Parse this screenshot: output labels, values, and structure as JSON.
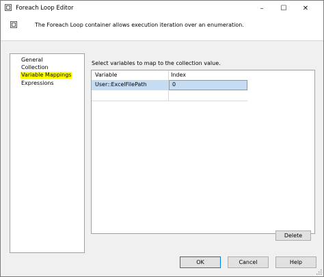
{
  "window": {
    "title": "Foreach Loop Editor",
    "controls": {
      "minimize": "–",
      "maximize": "☐",
      "close": "✕"
    }
  },
  "header": {
    "description": "The Foreach Loop container allows execution iteration over an enumeration."
  },
  "nav": {
    "items": [
      {
        "label": "General"
      },
      {
        "label": "Collection"
      },
      {
        "label": "Variable Mappings",
        "selected": true
      },
      {
        "label": "Expressions"
      }
    ],
    "highlight_color": "#ffff00"
  },
  "main": {
    "instruction": "Select variables to map to the collection value.",
    "grid": {
      "columns": [
        "Variable",
        "Index"
      ],
      "rows": [
        {
          "variable": "User::ExcelFilePath",
          "index": "0"
        }
      ]
    },
    "delete_label": "Delete"
  },
  "footer": {
    "ok_label": "OK",
    "cancel_label": "Cancel",
    "help_label": "Help"
  },
  "colors": {
    "selection": "#c5dcf3",
    "focus_border": "#0078d7"
  }
}
